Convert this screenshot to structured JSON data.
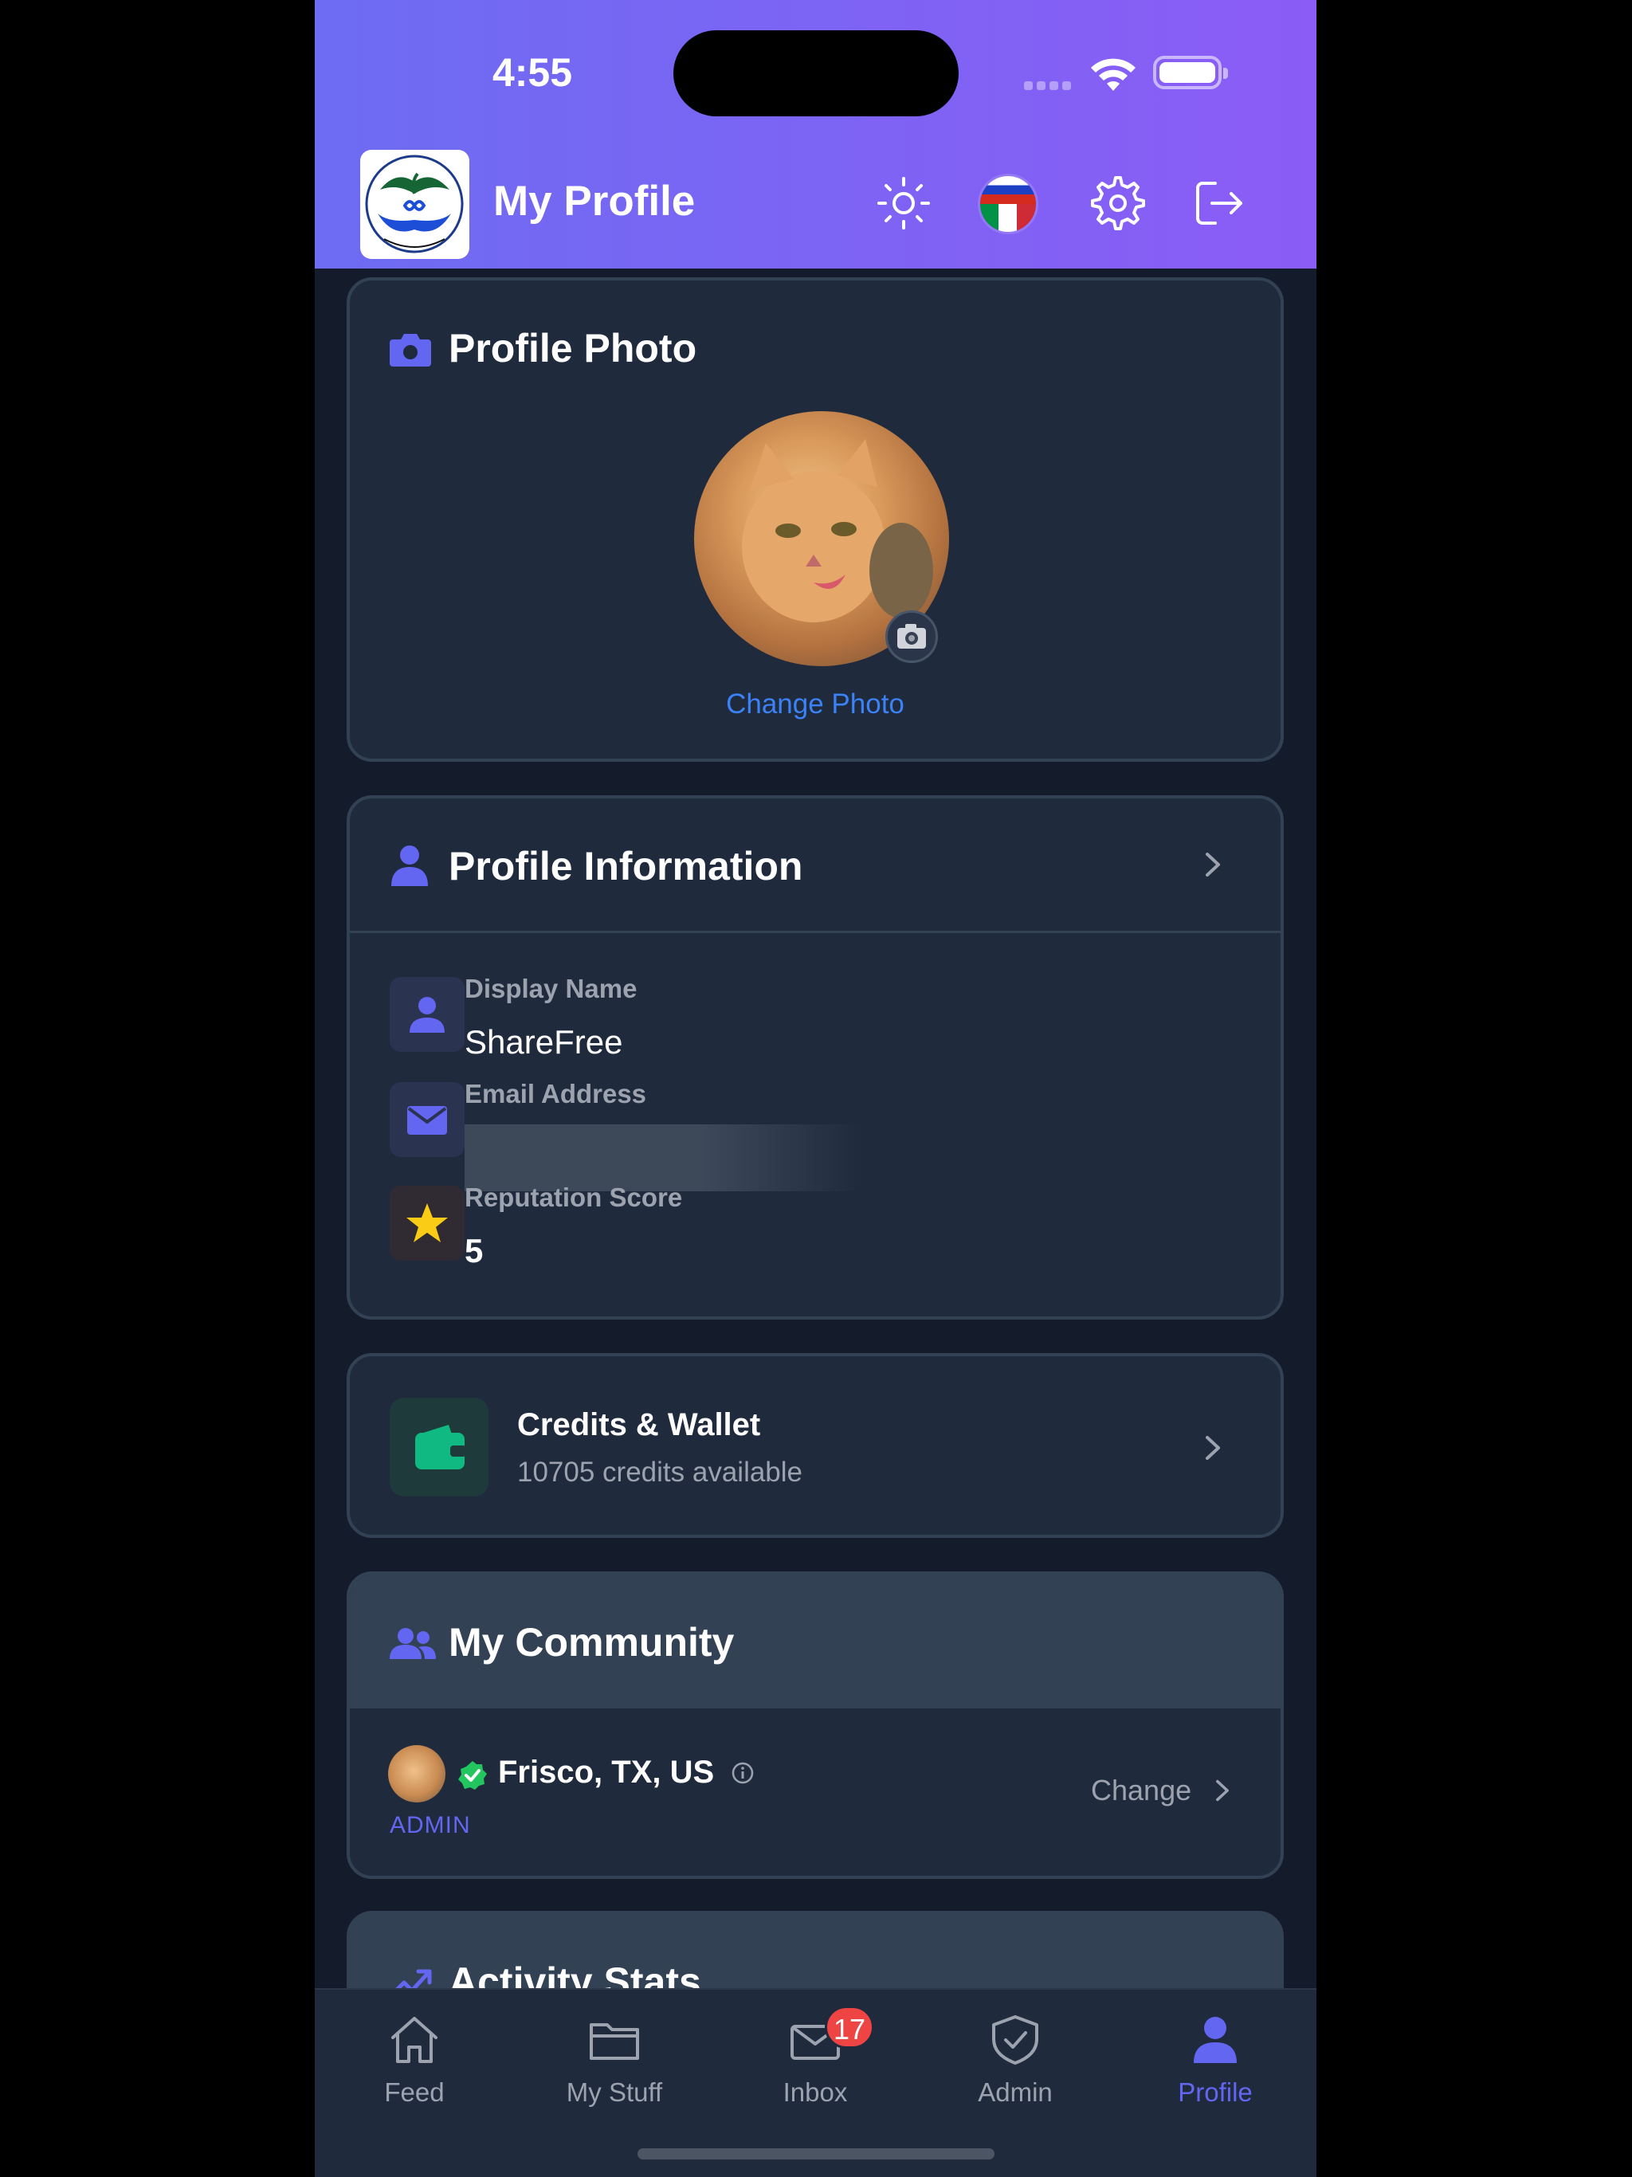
{
  "status_bar": {
    "time": "4:55"
  },
  "header": {
    "title": "My Profile",
    "logo_text": "ShareFree"
  },
  "profile_photo": {
    "title": "Profile Photo",
    "change_label": "Change Photo"
  },
  "profile_info": {
    "title": "Profile Information",
    "fields": [
      {
        "label": "Display Name",
        "value": "ShareFree"
      },
      {
        "label": "Email Address",
        "value": ""
      },
      {
        "label": "Reputation Score",
        "value": "5"
      }
    ]
  },
  "wallet": {
    "title": "Credits & Wallet",
    "subtitle": "10705 credits available"
  },
  "community": {
    "title": "My Community",
    "location": "Frisco, TX, US",
    "role": "ADMIN",
    "change_label": "Change"
  },
  "activity": {
    "title": "Activity Stats"
  },
  "tabs": [
    {
      "label": "Feed"
    },
    {
      "label": "My Stuff"
    },
    {
      "label": "Inbox",
      "badge": "17"
    },
    {
      "label": "Admin"
    },
    {
      "label": "Profile"
    }
  ],
  "colors": {
    "accent": "#6366f1",
    "link": "#3b82f6",
    "success": "#22c55e",
    "star": "#facc15",
    "badge": "#ef4444"
  }
}
